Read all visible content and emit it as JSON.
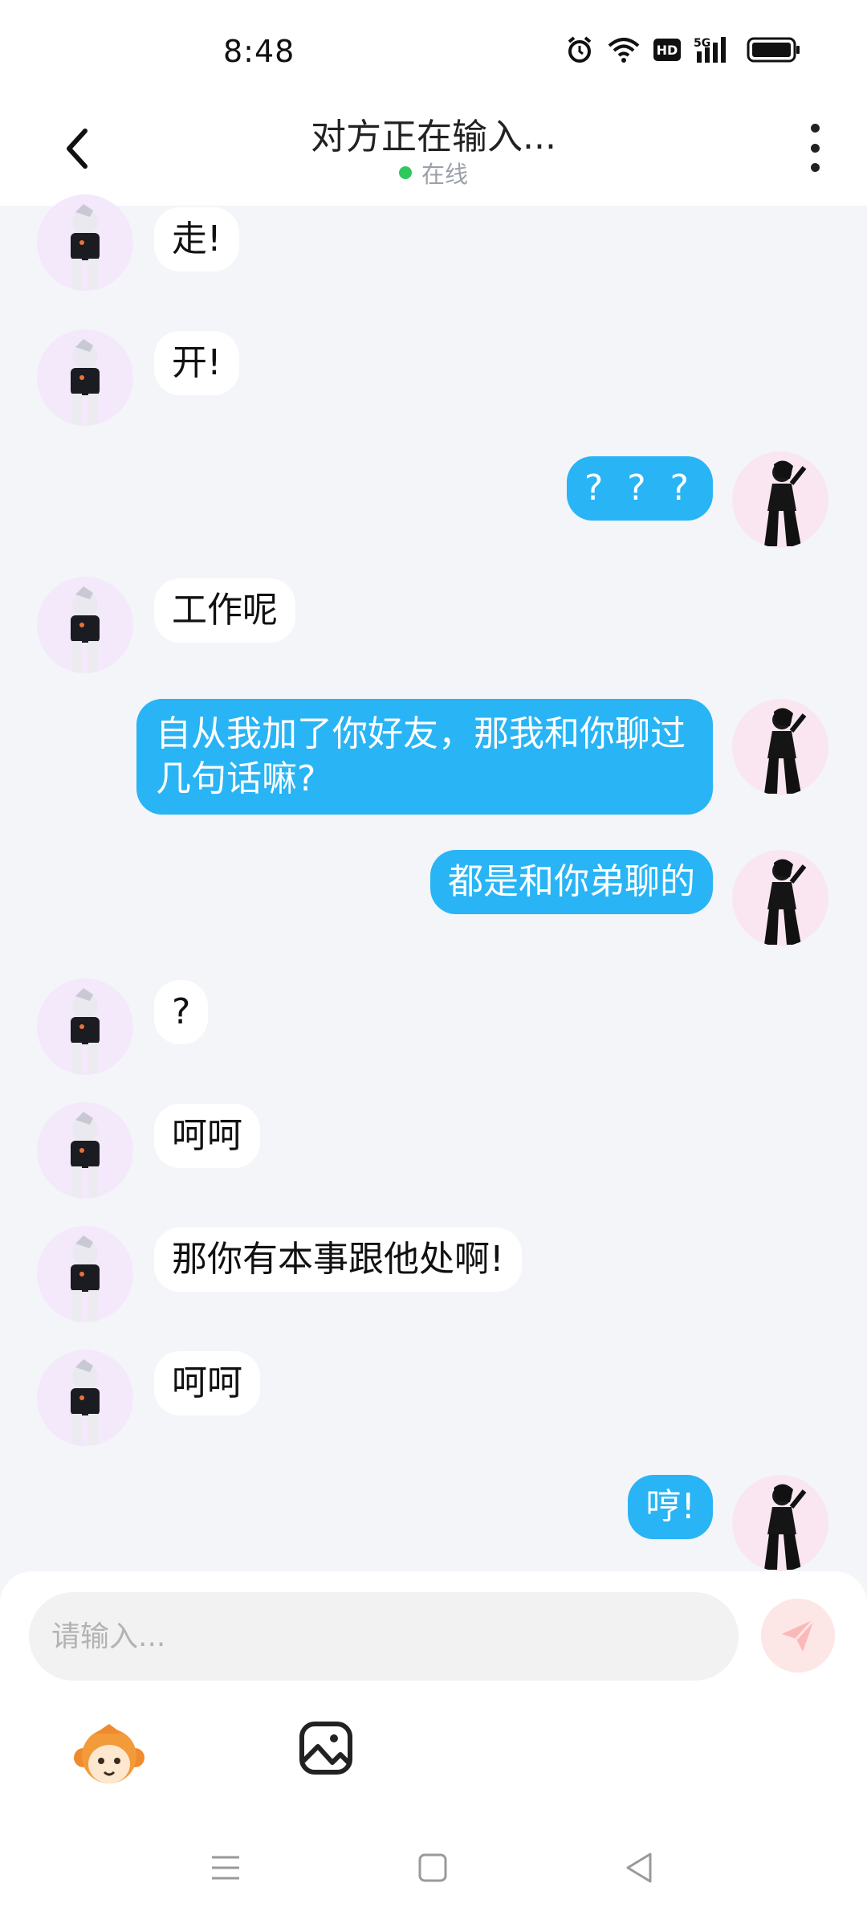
{
  "status_bar": {
    "time": "8:48",
    "icons": [
      "alarm-icon",
      "wifi-icon",
      "hd-icon",
      "signal-5g-icon",
      "battery-icon"
    ],
    "hd_label": "HD",
    "net_label": "5G"
  },
  "header": {
    "title": "对方正在输入...",
    "status": "在线",
    "online_color": "#2ec95c"
  },
  "colors": {
    "incoming_bubble": "#ffffff",
    "outgoing_bubble": "#29b4f5",
    "background": "#f3f5f9"
  },
  "messages": [
    {
      "side": "in",
      "text": "走!"
    },
    {
      "side": "in",
      "text": "开!"
    },
    {
      "side": "out",
      "text": "? ? ?"
    },
    {
      "side": "in",
      "text": "工作呢"
    },
    {
      "side": "out",
      "text": "自从我加了你好友，那我和你聊过几句话嘛?"
    },
    {
      "side": "out",
      "text": "都是和你弟聊的"
    },
    {
      "side": "in",
      "text": "?"
    },
    {
      "side": "in",
      "text": "呵呵"
    },
    {
      "side": "in",
      "text": "那你有本事跟他处啊!"
    },
    {
      "side": "in",
      "text": "呵呵"
    },
    {
      "side": "out",
      "text": "哼!"
    }
  ],
  "input": {
    "placeholder": "请输入..."
  }
}
